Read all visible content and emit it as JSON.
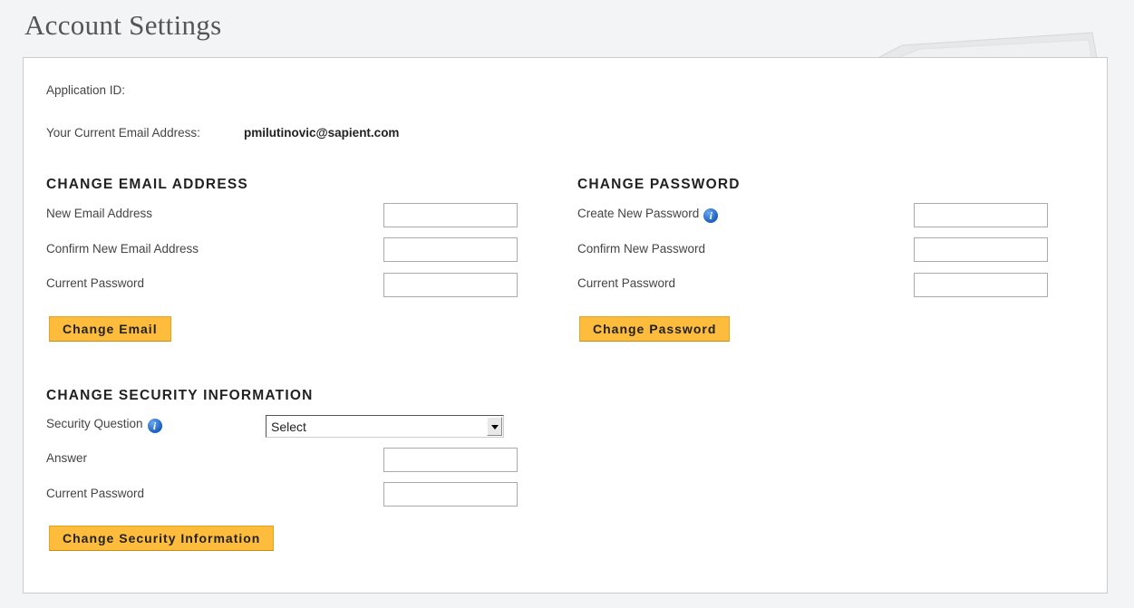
{
  "page": {
    "title": "Account Settings"
  },
  "account": {
    "application_id_label": "Application ID:",
    "application_id_value": "",
    "current_email_label": "Your Current Email Address:",
    "current_email_value": "pmilutinovic@sapient.com"
  },
  "change_email": {
    "heading": "CHANGE EMAIL ADDRESS",
    "new_email_label": "New Email Address",
    "confirm_email_label": "Confirm New Email Address",
    "current_password_label": "Current Password",
    "button": "Change Email"
  },
  "change_password": {
    "heading": "CHANGE PASSWORD",
    "new_password_label": "Create New Password",
    "confirm_password_label": "Confirm New Password",
    "current_password_label": "Current Password",
    "button": "Change Password"
  },
  "change_security": {
    "heading": "CHANGE SECURITY INFORMATION",
    "question_label": "Security Question",
    "question_selected": "Select",
    "answer_label": "Answer",
    "current_password_label": "Current Password",
    "button": "Change Security Information"
  },
  "icons": {
    "info": "info-icon",
    "dropdown": "chevron-down-icon"
  },
  "colors": {
    "button_bg": "#fdbc3b",
    "page_bg": "#f2f4f5",
    "info_icon": "#1b5fbf"
  }
}
